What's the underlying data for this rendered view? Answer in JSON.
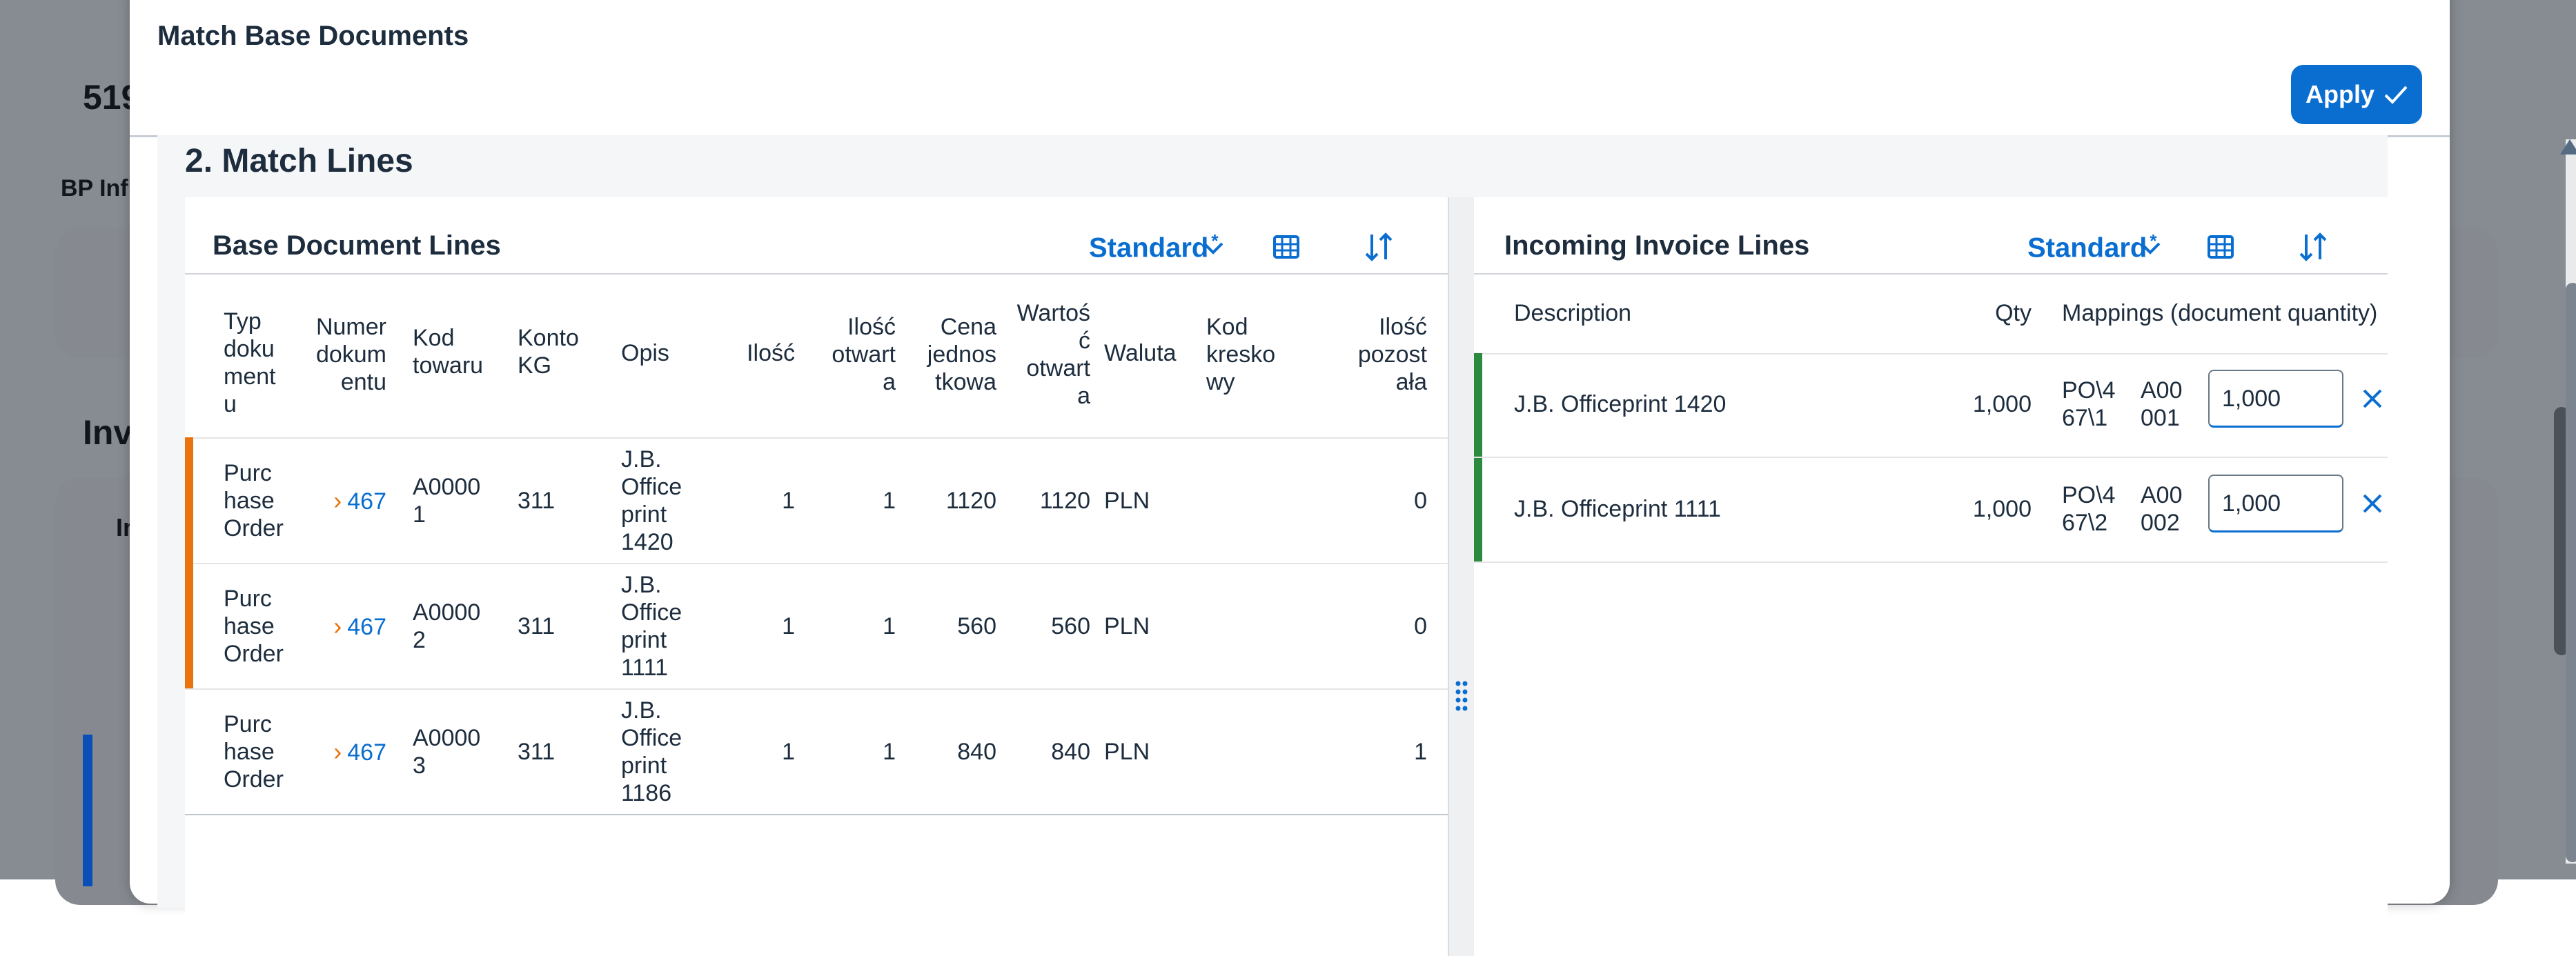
{
  "background": {
    "heading_fragment": "519",
    "tab_fragment": "BP Inf",
    "section_fragment": "Inv",
    "sub_fragment": "In"
  },
  "dialog": {
    "title": "Match Base Documents",
    "apply_label": "Apply",
    "section_title": "2. Match Lines"
  },
  "left_table": {
    "title": "Base Document Lines",
    "variant": "Standard",
    "variant_mark": "*",
    "columns": [
      "Typ dokumentu",
      "Numer dokumentu",
      "Kod towaru",
      "Konto KG",
      "Opis",
      "Ilość",
      "Ilość otwarta",
      "Cena jednostkowa",
      "Wartość otwarta",
      "Waluta",
      "Kod kreskowy",
      "Ilość pozostała"
    ],
    "rows": [
      {
        "type": "Purchase Order",
        "doc": "467",
        "item": "A00001",
        "account": "311",
        "desc": "J.B. Officeprint 1420",
        "qty": "1",
        "open_qty": "1",
        "unit_price": "1120",
        "open_value": "1120",
        "currency": "PLN",
        "barcode": "",
        "remaining": "0",
        "flag": "#e9730c"
      },
      {
        "type": "Purchase Order",
        "doc": "467",
        "item": "A00002",
        "account": "311",
        "desc": "J.B. Officeprint 1111",
        "qty": "1",
        "open_qty": "1",
        "unit_price": "560",
        "open_value": "560",
        "currency": "PLN",
        "barcode": "",
        "remaining": "0",
        "flag": "#e9730c"
      },
      {
        "type": "Purchase Order",
        "doc": "467",
        "item": "A00003",
        "account": "311",
        "desc": "J.B. Officeprint 1186",
        "qty": "1",
        "open_qty": "1",
        "unit_price": "840",
        "open_value": "840",
        "currency": "PLN",
        "barcode": "",
        "remaining": "1",
        "flag": ""
      }
    ]
  },
  "right_table": {
    "title": "Incoming Invoice Lines",
    "variant": "Standard",
    "variant_mark": "*",
    "columns": [
      "Description",
      "Qty",
      "Mappings (document quantity)"
    ],
    "rows": [
      {
        "desc": "J.B. Officeprint 1420",
        "qty": "1,000",
        "map_doc": "PO\\467\\1",
        "map_item": "A00001",
        "map_qty": "1,000",
        "flag": "#2b8a3e"
      },
      {
        "desc": "J.B. Officeprint 1111",
        "qty": "1,000",
        "map_doc": "PO\\467\\2",
        "map_item": "A00002",
        "map_qty": "1,000",
        "flag": "#2b8a3e"
      }
    ]
  },
  "colors": {
    "accent": "#0a6ed1",
    "orange_flag": "#e9730c",
    "green_flag": "#2b8a3e"
  }
}
